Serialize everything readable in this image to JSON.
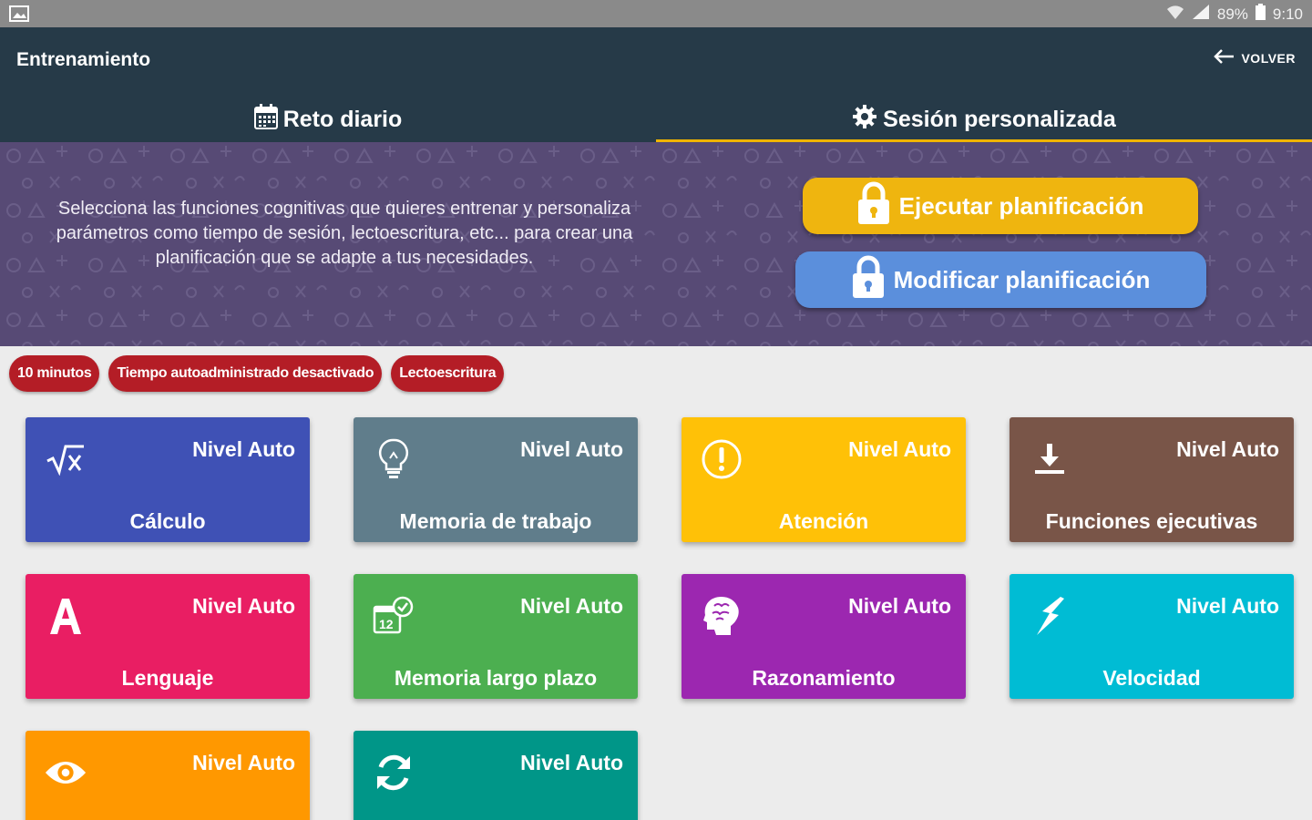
{
  "status_bar": {
    "battery": "89%",
    "time": "9:10"
  },
  "app_bar": {
    "title": "Entrenamiento",
    "back_label": "VOLVER"
  },
  "tabs": [
    {
      "label": "Reto diario",
      "icon": "calendar-icon",
      "active": false
    },
    {
      "label": "Sesión personalizada",
      "icon": "gear-icon",
      "active": true
    }
  ],
  "banner": {
    "description": "Selecciona las funciones cognitivas que quieres entrenar y personaliza parámetros como tiempo de sesión, lectoescritura, etc... para crear una planificación que se adapte a tus necesidades.",
    "execute_label": "Ejecutar planificación",
    "modify_label": "Modificar planificación"
  },
  "chips": [
    "10 minutos",
    "Tiempo autoadministrado desactivado",
    "Lectoescritura"
  ],
  "cards": [
    {
      "name": "Cálculo",
      "level": "Nivel Auto",
      "icon": "sqrt-icon",
      "color": "#3f51b5"
    },
    {
      "name": "Memoria de trabajo",
      "level": "Nivel Auto",
      "icon": "lightbulb-icon",
      "color": "#607d8b"
    },
    {
      "name": "Atención",
      "level": "Nivel Auto",
      "icon": "exclamation-icon",
      "color": "#ffc107"
    },
    {
      "name": "Funciones ejecutivas",
      "level": "Nivel Auto",
      "icon": "download-icon",
      "color": "#795548"
    },
    {
      "name": "Lenguaje",
      "level": "Nivel Auto",
      "icon": "letter-a-icon",
      "color": "#e91e63"
    },
    {
      "name": "Memoria largo plazo",
      "level": "Nivel Auto",
      "icon": "calendar-check-icon",
      "color": "#4caf50"
    },
    {
      "name": "Razonamiento",
      "level": "Nivel Auto",
      "icon": "brain-head-icon",
      "color": "#9c27b0"
    },
    {
      "name": "Velocidad",
      "level": "Nivel Auto",
      "icon": "lightning-icon",
      "color": "#00bcd4"
    },
    {
      "name": "",
      "level": "Nivel Auto",
      "icon": "eye-icon",
      "color": "#ff9800"
    },
    {
      "name": "",
      "level": "Nivel Auto",
      "icon": "refresh-icon",
      "color": "#009688"
    }
  ]
}
